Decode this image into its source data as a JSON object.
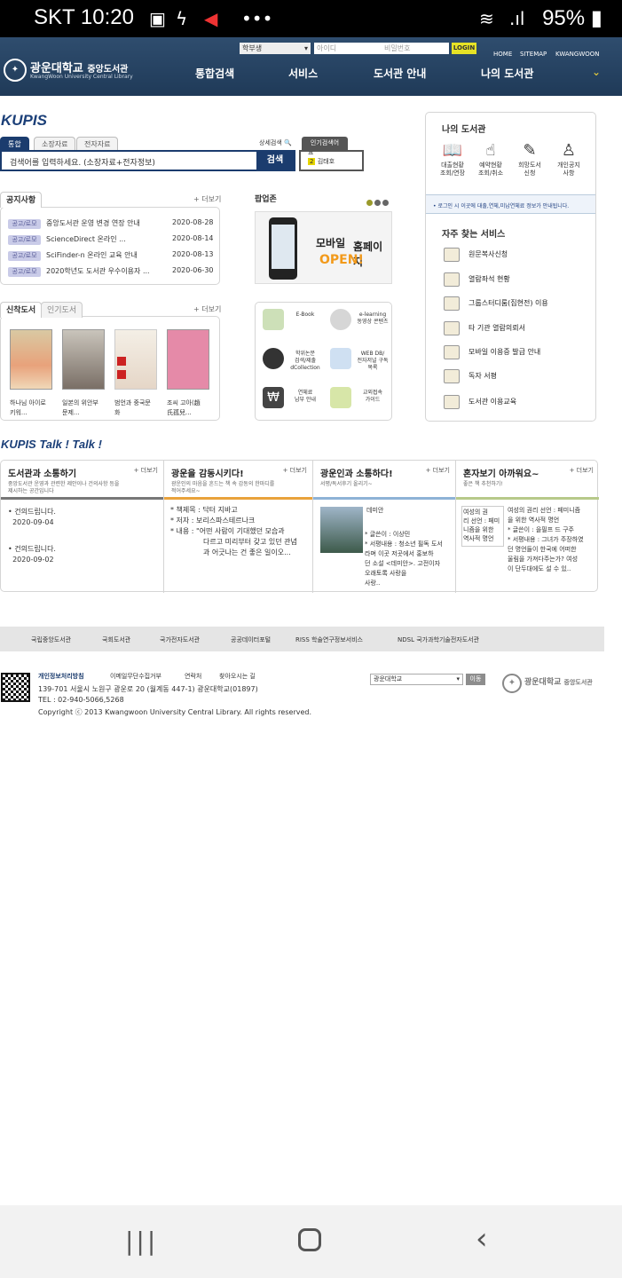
{
  "status": {
    "time": "SKT 10:20",
    "battery": "95%"
  },
  "header": {
    "logo_name": "광운대학교",
    "logo_lib": "중앙도서관",
    "logo_sub": "KwangWoon University Central Library",
    "user_type": "학부생",
    "id_placeholder": "아이디",
    "pw_placeholder": "비밀번호",
    "login_label": "LOGIN",
    "links": [
      "HOME",
      "SITEMAP",
      "KWANGWOON"
    ],
    "nav": [
      "통합검색",
      "서비스",
      "도서관 안내",
      "나의 도서관"
    ]
  },
  "search": {
    "brand": "KUPIS",
    "tabs": [
      "통합",
      "소장자료",
      "전자자료"
    ],
    "placeholder": "검색어를 입력하세요. (소장자료+전자정보)",
    "button": "검색",
    "advanced": "상세검색",
    "popular_tab": "인기검색어",
    "popular_items": [
      "요",
      "김태호"
    ]
  },
  "notice": {
    "tabs": [
      "공지사항"
    ],
    "more": "+ 더보기",
    "rows": [
      {
        "cat": "공고/로모",
        "title": "중앙도서관 운영 변경 연장 안내",
        "date": "2020-08-28"
      },
      {
        "cat": "공고/로모",
        "title": "ScienceDirect 온라인 ...",
        "date": "2020-08-14"
      },
      {
        "cat": "공고/로모",
        "title": "SciFinder-n 온라인 교육 안내",
        "date": "2020-08-13"
      },
      {
        "cat": "공고/로모",
        "title": "2020학년도 도서관 우수이용자 ...",
        "date": "2020-06-30"
      }
    ]
  },
  "popup": {
    "title": "팝업존",
    "line1": "모바일",
    "line2": "홈페이지",
    "line3": "OPEN!"
  },
  "books": {
    "tabs": [
      "신착도서",
      "인기도서"
    ],
    "more": "+ 더보기",
    "captions": [
      [
        "하나님 아이로",
        "키워..."
      ],
      [
        "일본의 위안부",
        "문제..."
      ],
      [
        "범언과 중국문",
        "화"
      ],
      [
        "조씨 고아(趙",
        "氏孤兒..."
      ]
    ]
  },
  "quick": [
    {
      "label1": "E-Book",
      "label2": ""
    },
    {
      "label1": "e-learning",
      "label2": "동영상 콘텐츠"
    },
    {
      "label1": "학위논문",
      "label2": "검색/제출 dCollection"
    },
    {
      "label1": "WEB DB/",
      "label2": "전자저널 구독목록"
    },
    {
      "label1": "연체료",
      "label2": "납부 안내"
    },
    {
      "label1": "교외접속",
      "label2": "가이드"
    }
  ],
  "mylib": {
    "title": "나의 도서관",
    "icons": [
      [
        "대출현황",
        "조회/연장"
      ],
      [
        "예약현황",
        "조회/취소"
      ],
      [
        "희망도서",
        "신청"
      ],
      [
        "개인공지",
        "사항"
      ]
    ],
    "note": "로그인 시 이곳에 대출,연체,미납연체료 정보가 안내됩니다."
  },
  "freq": {
    "title": "자주 찾는 서비스",
    "items": [
      "원문복사신청",
      "열람좌석 현황",
      "그룹스터디룸(집현전) 이용",
      "타 기관 열람의뢰서",
      "모바일 이용증 발급 안내",
      "독자 서평",
      "도서관 이용교육"
    ]
  },
  "talk": {
    "title": "KUPIS Talk ! Talk !",
    "more": "+ 더보기",
    "cols": [
      {
        "h": "도서관과 소통하기",
        "s1": "중앙도서관 운영과 관련한 제안이나 건의사항 등을",
        "s2": "제시하는 공간입니다"
      },
      {
        "h": "광운을 감동시키다!",
        "s1": "광운인의 마음을 흔드는 책 속 감동의 한마디를",
        "s2": "적어주세요~"
      },
      {
        "h": "광운인과 소통하다!",
        "s1": "서평/독서후기 올리기~",
        "s2": ""
      },
      {
        "h": "혼자보기 아까워요~",
        "s1": "좋은 책 추천하기!",
        "s2": ""
      }
    ],
    "col1": [
      [
        "건의드립니다.",
        "2020-09-04"
      ],
      [
        "건의드립니다.",
        "2020-09-02"
      ]
    ],
    "col2": {
      "lines": [
        "* 책제목 :  닥터 지바고",
        "* 저자 :  보리스파스테르나크",
        "* 내용 :  \"어떤 사람이 기대했던 모습과",
        "다르고 미리부터 갖고 있던 관념",
        "과 어긋나는 건 좋은 일이오..."
      ]
    },
    "col3": {
      "book": "데미안",
      "lines": [
        "* 글쓴이 : 이상민",
        "* 서평내용 : 청소년 필독 도서",
        "라며 이곳 저곳에서 홍보하",
        "던 소설 <데미안>. 고전이자",
        "오래토록 사랑을",
        "사랑.."
      ]
    },
    "col4": {
      "img_alt": [
        "여성의 권",
        "리 선언 : 페미",
        "니즘을 위한",
        "역사적 명언"
      ],
      "lines": [
        "여성의 권리 선언 : 페미니즘",
        "을 위한 역사적 명언",
        "* 글쓴이 : 을필프 드 구주",
        "* 서평내용 : 그녀가 주장하였",
        "던 명언들이 한국에 어떠한",
        "울림을 가져다주는가? 여성",
        "이 단두대에도 설 수 있.."
      ]
    }
  },
  "footer": {
    "links": [
      "국립중앙도서관",
      "국회도서관",
      "국가전자도서관",
      "공공데이터포털",
      "RISS 학술연구정보서비스",
      "NDSL 국가과학기술전자도서관"
    ],
    "policy": [
      "개인정보처리방침",
      "이메일무단수집거부",
      "연락처",
      "찾아오시는 길"
    ],
    "address": "139-701 서울시 노원구 광운로 20 (월계동 447-1) 광운대학교(01897)",
    "tel": "TEL : 02-940-5066,5268",
    "copyright": "Copyright ⓒ 2013 Kwangwoon University Central Library. All rights reserved.",
    "site_select": "광운대학교",
    "go": "이동",
    "logo_name": "광운대학교",
    "logo_lib": "중앙도서관"
  },
  "colors": {
    "navy": "#1b3c6e",
    "header": "#2f4d6e",
    "login": "#e6e226",
    "accent": "#f29a1b"
  }
}
